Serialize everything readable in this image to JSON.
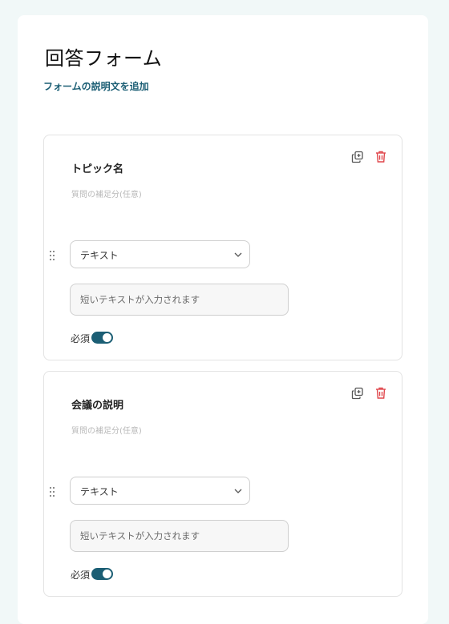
{
  "form": {
    "title": "回答フォーム",
    "add_description_link": "フォームの説明文を追加"
  },
  "colors": {
    "accent": "#1b5e74",
    "delete": "#e0474c",
    "page_background": "#f1f8f8"
  },
  "questions": [
    {
      "title": "トピック名",
      "subtitle": "質問の補足分(任意)",
      "type_selected": "テキスト",
      "answer_placeholder": "短いテキストが入力されます",
      "required_label": "必須",
      "required": true
    },
    {
      "title": "会議の説明",
      "subtitle": "質問の補足分(任意)",
      "type_selected": "テキスト",
      "answer_placeholder": "短いテキストが入力されます",
      "required_label": "必須",
      "required": true
    }
  ],
  "icons": {
    "copy": "copy-icon",
    "delete": "trash-icon",
    "drag": "drag-handle-icon",
    "dropdown": "chevron-down-icon"
  }
}
